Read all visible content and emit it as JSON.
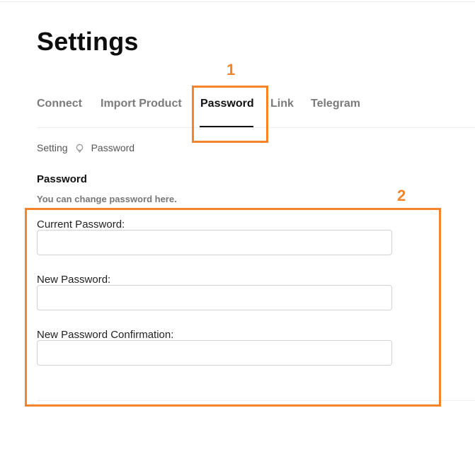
{
  "page": {
    "title": "Settings"
  },
  "tabs": [
    {
      "label": "Connect"
    },
    {
      "label": "Import Product"
    },
    {
      "label": "Password"
    },
    {
      "label": "Link"
    },
    {
      "label": "Telegram"
    }
  ],
  "active_tab": "Password",
  "breadcrumb": {
    "parent": "Setting",
    "separator_icon": "location-pin-icon",
    "current": "Password"
  },
  "section": {
    "title": "Password",
    "subtitle": "You can change password here."
  },
  "form": {
    "current_password_label": "Current Password:",
    "current_password_value": "",
    "new_password_label": "New Password:",
    "new_password_value": "",
    "confirm_password_label": "New Password Confirmation:",
    "confirm_password_value": ""
  },
  "annotations": {
    "marker_1": "1",
    "marker_2": "2",
    "color": "#f5832a"
  }
}
